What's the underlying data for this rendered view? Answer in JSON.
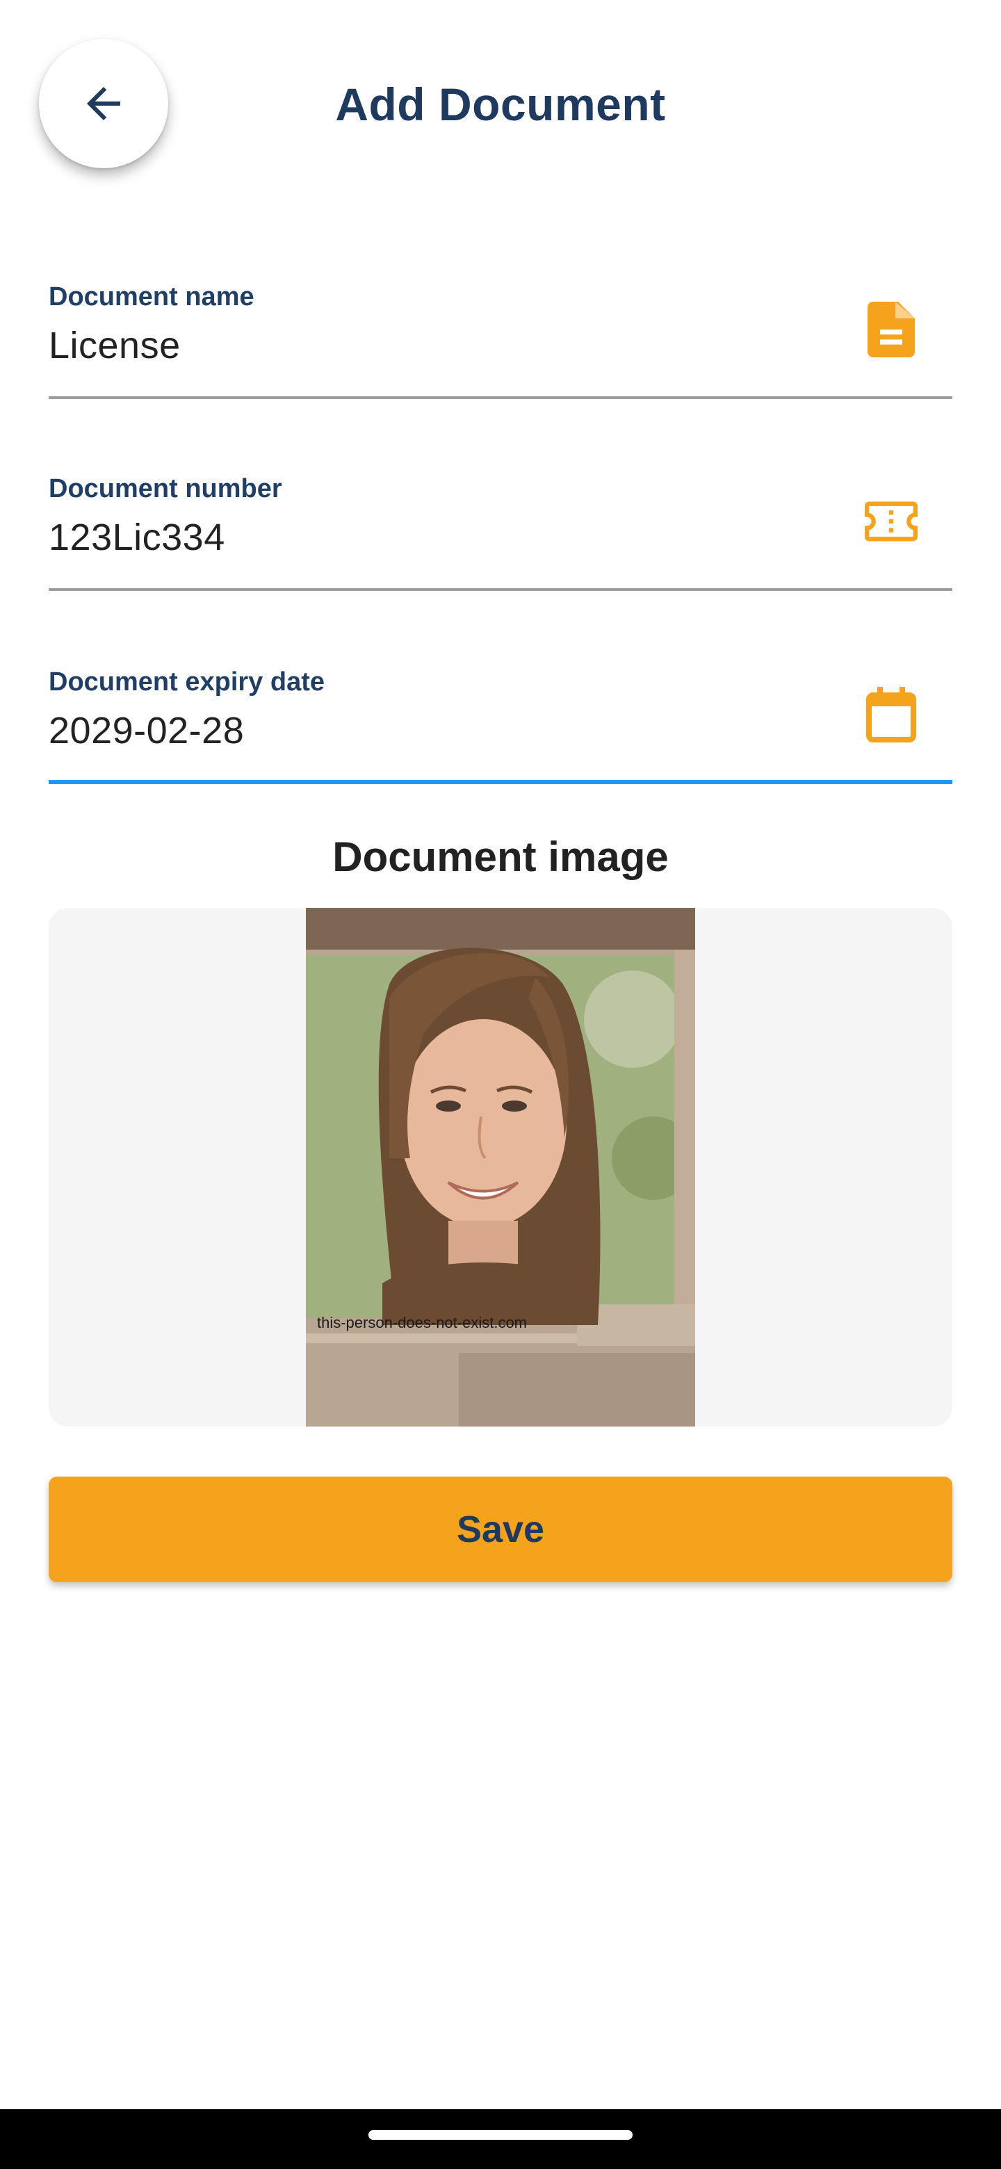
{
  "header": {
    "title": "Add Document",
    "back_icon": "arrow-back-icon"
  },
  "fields": {
    "name": {
      "label": "Document name",
      "value": "License",
      "icon": "document-icon"
    },
    "number": {
      "label": "Document number",
      "value": "123Lic334",
      "icon": "ticket-icon"
    },
    "expiry": {
      "label": "Document expiry date",
      "value": "2029-02-28",
      "icon": "calendar-icon"
    }
  },
  "image_section": {
    "title": "Document image",
    "watermark": "this-person-does-not-exist.com"
  },
  "actions": {
    "save_label": "Save"
  },
  "colors": {
    "primary_text": "#1e3a5f",
    "accent_orange": "#f5a31c",
    "focus_blue": "#2196f3",
    "divider_gray": "#9e9e9e",
    "panel_bg": "#f5f5f5"
  }
}
